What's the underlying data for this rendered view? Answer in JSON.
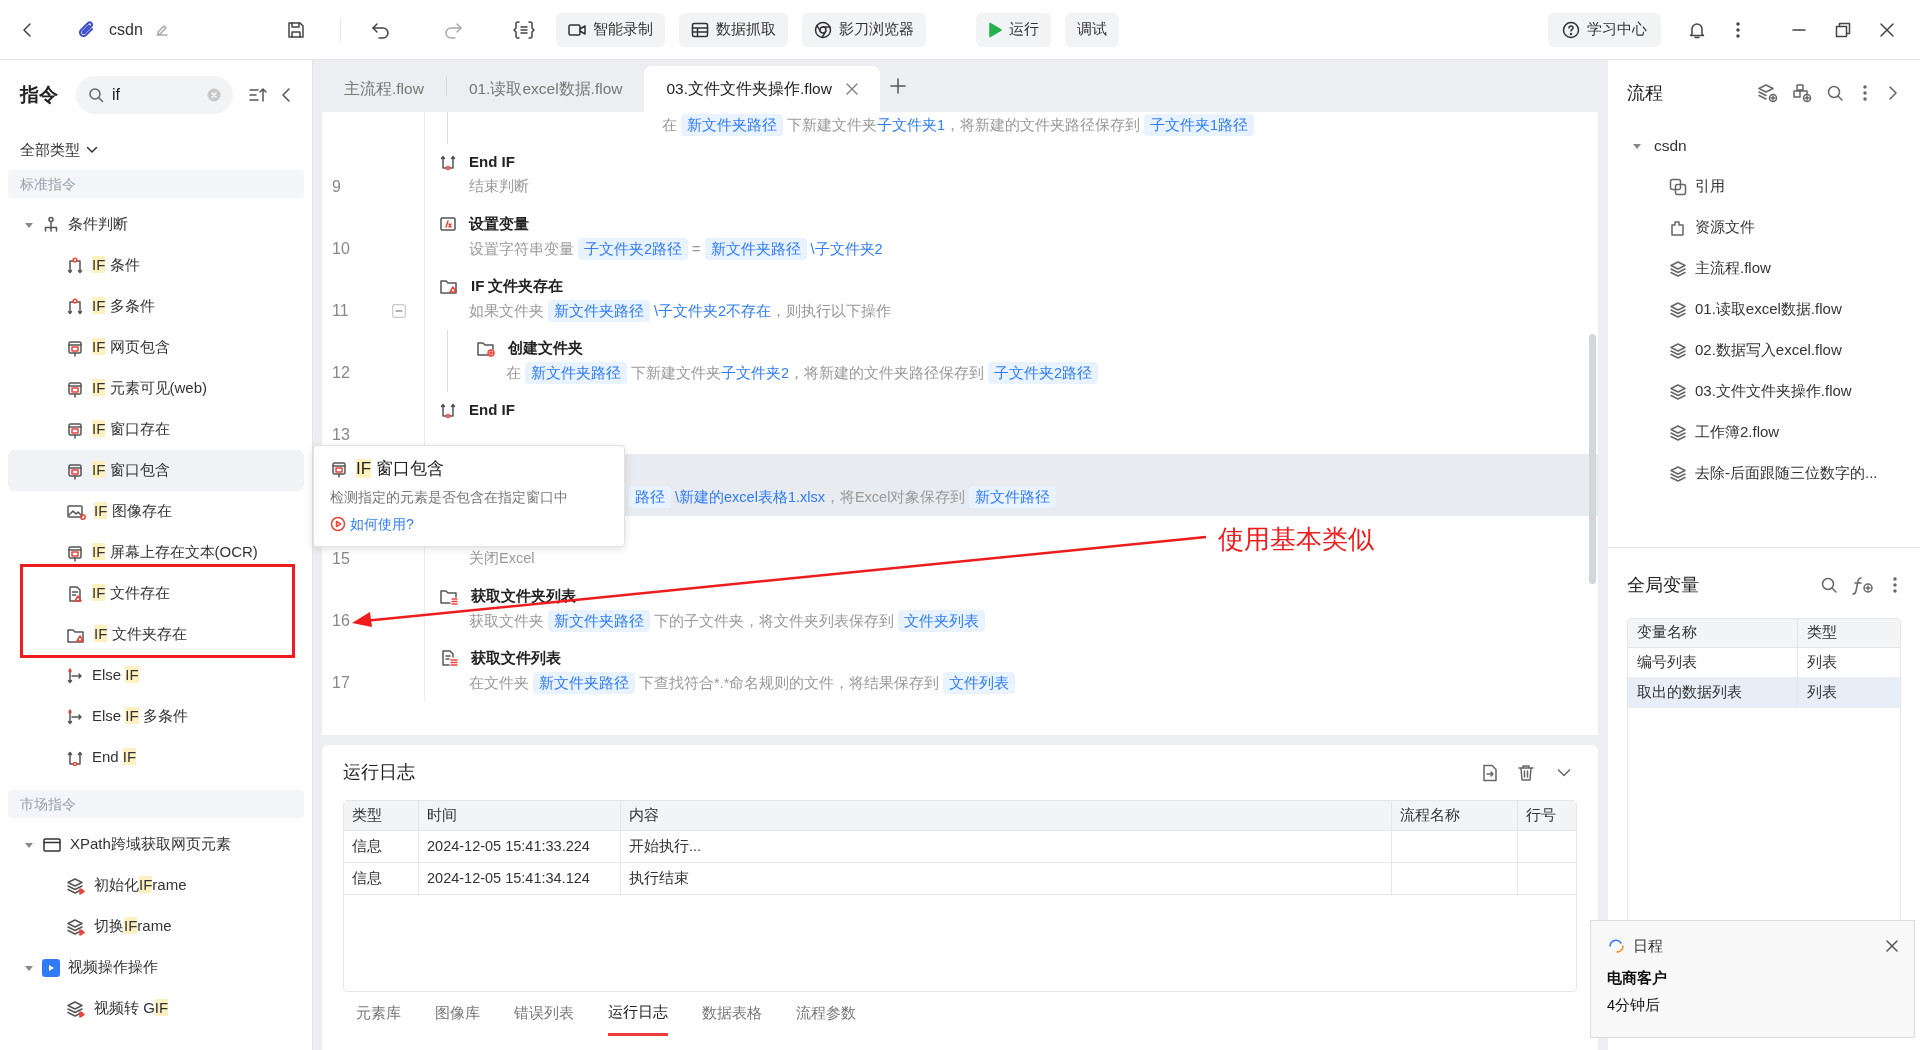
{
  "toolbar": {
    "project": "csdn",
    "buttons": [
      {
        "kind": "record",
        "label": "智能录制"
      },
      {
        "kind": "grab",
        "label": "数据抓取"
      },
      {
        "kind": "browser",
        "label": "影刀浏览器"
      },
      {
        "kind": "run",
        "label": "运行"
      },
      {
        "kind": "debug",
        "label": "调试"
      }
    ],
    "help": "学习中心"
  },
  "commands": {
    "title": "指令",
    "search": {
      "value": "if"
    },
    "filter": "全部类型",
    "sections": [
      {
        "title": "标准指令",
        "items": [
          {
            "kind": "branch",
            "parts": [
              {
                "text": "条件判断",
                "match": false
              }
            ],
            "expanded": true,
            "selected": false,
            "children": [
              {
                "kind": "condition",
                "parts": [
                  {
                    "text": "IF",
                    "match": true
                  },
                  {
                    "text": " 条件",
                    "match": false
                  }
                ],
                "selected": false
              },
              {
                "kind": "condition",
                "parts": [
                  {
                    "text": "IF",
                    "match": true
                  },
                  {
                    "text": " 多条件",
                    "match": false
                  }
                ],
                "selected": false
              },
              {
                "kind": "web",
                "parts": [
                  {
                    "text": "IF",
                    "match": true
                  },
                  {
                    "text": " 网页包含",
                    "match": false
                  }
                ],
                "selected": false
              },
              {
                "kind": "web",
                "parts": [
                  {
                    "text": "IF",
                    "match": true
                  },
                  {
                    "text": " 元素可见(web)",
                    "match": false
                  }
                ],
                "selected": false
              },
              {
                "kind": "web",
                "parts": [
                  {
                    "text": "IF",
                    "match": true
                  },
                  {
                    "text": " 窗口存在",
                    "match": false
                  }
                ],
                "selected": false
              },
              {
                "kind": "web",
                "parts": [
                  {
                    "text": "IF",
                    "match": true
                  },
                  {
                    "text": " 窗口包含",
                    "match": false
                  }
                ],
                "selected": true
              },
              {
                "kind": "image",
                "parts": [
                  {
                    "text": "IF",
                    "match": true
                  },
                  {
                    "text": " 图像存在",
                    "match": false
                  }
                ],
                "selected": false
              },
              {
                "kind": "web",
                "parts": [
                  {
                    "text": "IF",
                    "match": true
                  },
                  {
                    "text": " 屏幕上存在文本(OCR)",
                    "match": false
                  }
                ],
                "selected": false
              },
              {
                "kind": "file",
                "parts": [
                  {
                    "text": "IF",
                    "match": true
                  },
                  {
                    "text": " 文件存在",
                    "match": false
                  }
                ],
                "selected": false
              },
              {
                "kind": "folder",
                "parts": [
                  {
                    "text": "IF",
                    "match": true
                  },
                  {
                    "text": " 文件夹存在",
                    "match": false
                  }
                ],
                "selected": false
              },
              {
                "kind": "else",
                "parts": [
                  {
                    "text": "Else ",
                    "match": false
                  },
                  {
                    "text": "IF",
                    "match": true
                  }
                ],
                "selected": false
              },
              {
                "kind": "else",
                "parts": [
                  {
                    "text": "Else ",
                    "match": false
                  },
                  {
                    "text": "IF",
                    "match": true
                  },
                  {
                    "text": " 多条件",
                    "match": false
                  }
                ],
                "selected": false
              },
              {
                "kind": "end",
                "parts": [
                  {
                    "text": "End ",
                    "match": false
                  },
                  {
                    "text": "IF",
                    "match": true
                  }
                ],
                "selected": false
              }
            ]
          }
        ]
      },
      {
        "title": "市场指令",
        "items": [
          {
            "kind": "browser",
            "parts": [
              {
                "text": "XPath跨域获取网页元素",
                "match": false
              }
            ],
            "expanded": true,
            "selected": false,
            "children": [
              {
                "kind": "layers",
                "parts": [
                  {
                    "text": "初始化",
                    "match": false
                  },
                  {
                    "text": "IF",
                    "match": true
                  },
                  {
                    "text": "rame",
                    "match": false
                  }
                ],
                "selected": false
              },
              {
                "kind": "layers",
                "parts": [
                  {
                    "text": "切换",
                    "match": false
                  },
                  {
                    "text": "IF",
                    "match": true
                  },
                  {
                    "text": "rame",
                    "match": false
                  }
                ],
                "selected": false
              }
            ]
          },
          {
            "kind": "video",
            "parts": [
              {
                "text": "视频操作操作",
                "match": false
              }
            ],
            "expanded": true,
            "selected": false,
            "children": [
              {
                "kind": "layers",
                "parts": [
                  {
                    "text": "视频转 G",
                    "match": false
                  },
                  {
                    "text": "IF",
                    "match": true
                  }
                ],
                "selected": false
              }
            ]
          }
        ]
      }
    ]
  },
  "tabs": [
    {
      "label": "主流程.flow",
      "selected": false
    },
    {
      "label": "01.读取excel数据.flow",
      "selected": false
    },
    {
      "label": "03.文件文件夹操作.flow",
      "selected": true
    }
  ],
  "steps": [
    {
      "children": [
        {
          "selected": false,
          "desc": [
            {
              "kind": "text",
              "text": "在"
            },
            {
              "kind": "var",
              "text": "新文件夹路径"
            },
            {
              "kind": "text",
              "text": "下新建文件夹"
            },
            {
              "kind": "value",
              "text": "子文件夹1"
            },
            {
              "kind": "text",
              "text": "，将新建的文件夹路径保存到"
            },
            {
              "kind": "var",
              "text": "子文件夹1路径"
            }
          ]
        }
      ]
    },
    {
      "number": "9",
      "kind": "endif",
      "title": "End IF",
      "selected": false,
      "desc": [
        {
          "kind": "text",
          "text": "结束判断"
        }
      ]
    },
    {
      "number": "10",
      "kind": "setvar",
      "title": "设置变量",
      "selected": false,
      "desc": [
        {
          "kind": "text",
          "text": "设置字符串变量"
        },
        {
          "kind": "var",
          "text": "子文件夹2路径"
        },
        {
          "kind": "text",
          "text": "="
        },
        {
          "kind": "var",
          "text": "新文件夹路径"
        },
        {
          "kind": "value",
          "text": "\\子文件夹2"
        }
      ]
    },
    {
      "number": "11",
      "kind": "iffolder",
      "title": "IF 文件夹存在",
      "selected": false,
      "expanded": true,
      "desc": [
        {
          "kind": "text",
          "text": "如果文件夹"
        },
        {
          "kind": "var",
          "text": "新文件夹路径"
        },
        {
          "kind": "value",
          "text": "\\子文件夹2不存在"
        },
        {
          "kind": "text",
          "text": "，则执行以下操作"
        }
      ],
      "children": [
        {
          "number": "12",
          "kind": "mkdir",
          "title": "创建文件夹",
          "selected": false,
          "desc": [
            {
              "kind": "text",
              "text": "在"
            },
            {
              "kind": "var",
              "text": "新文件夹路径"
            },
            {
              "kind": "text",
              "text": "下新建文件夹"
            },
            {
              "kind": "value",
              "text": "子文件夹2"
            },
            {
              "kind": "text",
              "text": "，将新建的文件夹路径保存到"
            },
            {
              "kind": "var",
              "text": "子文件夹2路径"
            }
          ]
        }
      ]
    },
    {
      "number": "13",
      "kind": "endif",
      "title": "End IF",
      "selected": false
    },
    {
      "selected": true,
      "desc": [
        {
          "kind": "var",
          "text": "路径"
        },
        {
          "kind": "value",
          "text": "\\新建的excel表格1.xlsx"
        },
        {
          "kind": "text",
          "text": "，将Excel对象保存到"
        },
        {
          "kind": "var",
          "text": "新文件路径"
        }
      ]
    },
    {
      "number": "15",
      "selected": false,
      "desc": [
        {
          "kind": "text",
          "text": "关闭Excel"
        }
      ]
    },
    {
      "number": "16",
      "kind": "listfolders",
      "title": "获取文件夹列表",
      "selected": false,
      "desc": [
        {
          "kind": "text",
          "text": "获取文件夹"
        },
        {
          "kind": "var",
          "text": "新文件夹路径"
        },
        {
          "kind": "text",
          "text": "下的子文件夹，将文件夹列表保存到"
        },
        {
          "kind": "var",
          "text": "文件夹列表"
        }
      ]
    },
    {
      "number": "17",
      "kind": "listfiles",
      "title": "获取文件列表",
      "selected": false,
      "desc": [
        {
          "kind": "text",
          "text": "在文件夹"
        },
        {
          "kind": "var",
          "text": "新文件夹路径"
        },
        {
          "kind": "text",
          "text": "下查找符合*.*命名规则的文件，将结果保存到"
        },
        {
          "kind": "var",
          "text": "文件列表"
        }
      ]
    }
  ],
  "tooltip": {
    "parts": [
      {
        "text": "IF",
        "match": true
      },
      {
        "text": " 窗口包含",
        "match": false
      }
    ],
    "description": "检测指定的元素是否包含在指定窗口中",
    "link": "如何使用?"
  },
  "annotation": {
    "text": "使用基本类似"
  },
  "log": {
    "title": "运行日志",
    "columns": [
      "类型",
      "时间",
      "内容",
      "流程名称",
      "行号"
    ],
    "rows": [
      {
        "type": "信息",
        "time": "2024-12-05 15:41:33.224",
        "content": "开始执行..."
      },
      {
        "type": "信息",
        "time": "2024-12-05 15:41:34.124",
        "content": "执行结束"
      }
    ],
    "tabs": [
      {
        "label": "元素库",
        "selected": false
      },
      {
        "label": "图像库",
        "selected": false
      },
      {
        "label": "错误列表",
        "selected": false
      },
      {
        "label": "运行日志",
        "selected": true
      },
      {
        "label": "数据表格",
        "selected": false
      },
      {
        "label": "流程参数",
        "selected": false
      }
    ]
  },
  "flows": {
    "title": "流程",
    "root": {
      "label": "csdn",
      "expanded": true,
      "children": [
        {
          "kind": "ref",
          "label": "引用"
        },
        {
          "kind": "resource",
          "label": "资源文件"
        },
        {
          "kind": "flow",
          "label": "主流程.flow"
        },
        {
          "kind": "flow",
          "label": "01.读取excel数据.flow"
        },
        {
          "kind": "flow",
          "label": "02.数据写入excel.flow"
        },
        {
          "kind": "flow",
          "label": "03.文件文件夹操作.flow"
        },
        {
          "kind": "flow",
          "label": "工作簿2.flow"
        },
        {
          "kind": "flow",
          "label": "去除-后面跟随三位数字的..."
        }
      ]
    }
  },
  "globals": {
    "title": "全局变量",
    "columns": [
      "变量名称",
      "类型"
    ],
    "rows": [
      {
        "cells": [
          "编号列表",
          "列表"
        ],
        "selected": false
      },
      {
        "cells": [
          "取出的数据列表",
          "列表"
        ],
        "selected": true
      }
    ]
  },
  "notification": {
    "title": "日程",
    "subject": "电商客户",
    "time": "4分钟后"
  }
}
